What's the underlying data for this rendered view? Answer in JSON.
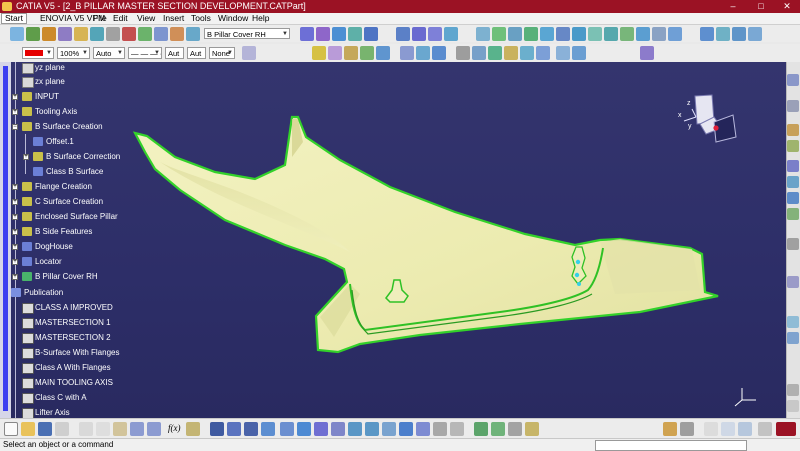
{
  "window": {
    "title": "CATIA V5 - [2_B PILLAR MASTER SECTION DEVELOPMENT.CATPart]",
    "minimize_glyph": "–",
    "restore_glyph": "□",
    "close_glyph": "✕"
  },
  "menu": {
    "items": [
      "Start",
      "ENOVIA V5 VPM",
      "File",
      "Edit",
      "View",
      "Insert",
      "Tools",
      "Window",
      "Help"
    ]
  },
  "properties_toolbar": {
    "fill_color": "#e60000",
    "transparency": "100%",
    "line_thickness": "Auto",
    "line_type": "— — — ·",
    "linetype_auto": "Aut",
    "weight_auto": "Aut",
    "layer": "None"
  },
  "part_selector": {
    "value": "B Pillar Cover RH"
  },
  "tree": {
    "items": [
      {
        "label": "yz plane"
      },
      {
        "label": "zx plane"
      },
      {
        "label": "INPUT"
      },
      {
        "label": "Tooling Axis"
      },
      {
        "label": "B Surface Creation"
      },
      {
        "label": "Offset.1"
      },
      {
        "label": "B Surface Correction"
      },
      {
        "label": "Class B Surface"
      },
      {
        "label": "Flange Creation"
      },
      {
        "label": "C Surface Creation"
      },
      {
        "label": "Enclosed Surface Pillar"
      },
      {
        "label": "B Side Features"
      },
      {
        "label": "DogHouse"
      },
      {
        "label": "Locator"
      },
      {
        "label": "B Pillar Cover RH"
      },
      {
        "label": "Publication"
      },
      {
        "label": "CLASS A IMPROVED"
      },
      {
        "label": "MASTERSECTION 1"
      },
      {
        "label": "MASTERSECTION 2"
      },
      {
        "label": "B-Surface With Flanges"
      },
      {
        "label": "Class A With Flanges"
      },
      {
        "label": "MAIN TOOLING AXIS"
      },
      {
        "label": "Class C with A"
      },
      {
        "label": "Lifter Axis"
      }
    ]
  },
  "compass": {
    "x_label": "x",
    "y_label": "y",
    "z_label": "z"
  },
  "bottom_toolbar": {
    "formula_label": "f(x)"
  },
  "status": {
    "message": "Select an object or a command"
  },
  "colors": {
    "viewport_background": "#2d2e68",
    "surface_fill": "#f1f0b6",
    "surface_edge": "#33d12a",
    "title_bar": "#9b1224",
    "spec_tree_line": "#3c3ff0"
  }
}
